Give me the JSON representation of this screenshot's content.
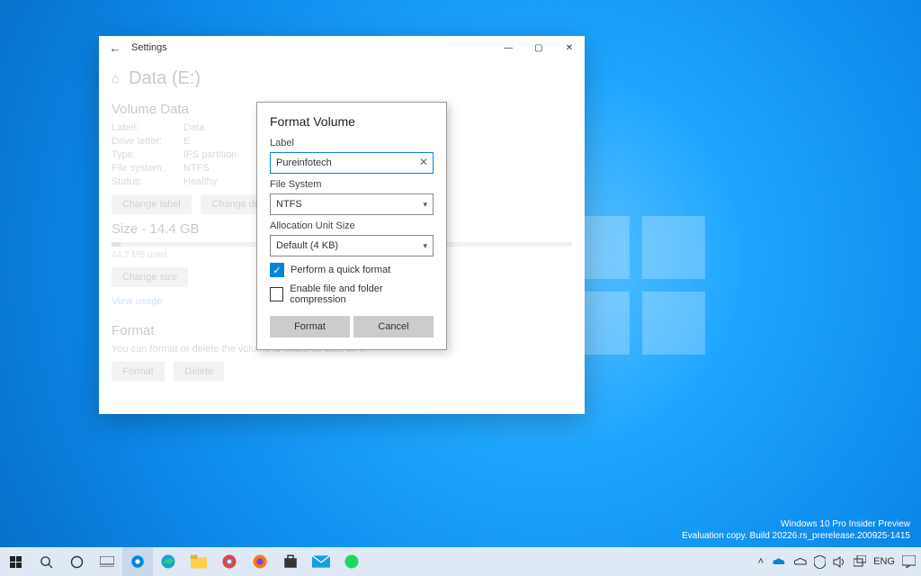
{
  "desktop": {
    "watermark_line1": "Windows 10 Pro Insider Preview",
    "watermark_line2": "Evaluation copy. Build 20226.rs_prerelease.200925-1415"
  },
  "window": {
    "app_title": "Settings",
    "page_title": "Data (E:)",
    "sections": {
      "volume": {
        "heading": "Volume Data",
        "rows": {
          "label_k": "Label:",
          "label_v": "Data",
          "drive_k": "Drive letter:",
          "drive_v": "E",
          "type_k": "Type:",
          "type_v": "IFS partition",
          "fs_k": "File system:",
          "fs_v": "NTFS",
          "status_k": "Status:",
          "status_v": "Healthy"
        },
        "buttons": {
          "change_label": "Change label",
          "change_drive": "Change drive letter"
        }
      },
      "size": {
        "heading": "Size - 14.4 GB",
        "usage": "44.2 MB used",
        "change_size": "Change size",
        "view_usage": "View usage"
      },
      "format": {
        "heading": "Format",
        "desc": "You can format or delete the volume to erase all data on it.",
        "format_btn": "Format",
        "delete_btn": "Delete"
      }
    }
  },
  "dialog": {
    "title": "Format Volume",
    "label_label": "Label",
    "label_value": "Pureinfotech",
    "fs_label": "File System",
    "fs_value": "NTFS",
    "alloc_label": "Allocation Unit Size",
    "alloc_value": "Default (4 KB)",
    "quick_label": "Perform a quick format",
    "compress_label": "Enable file and folder compression",
    "format_btn": "Format",
    "cancel_btn": "Cancel"
  },
  "taskbar": {
    "lang": "ENG",
    "time": "",
    "tray_icons": [
      "chevron-up",
      "onedrive",
      "cloud",
      "defender",
      "volume",
      "network"
    ]
  }
}
